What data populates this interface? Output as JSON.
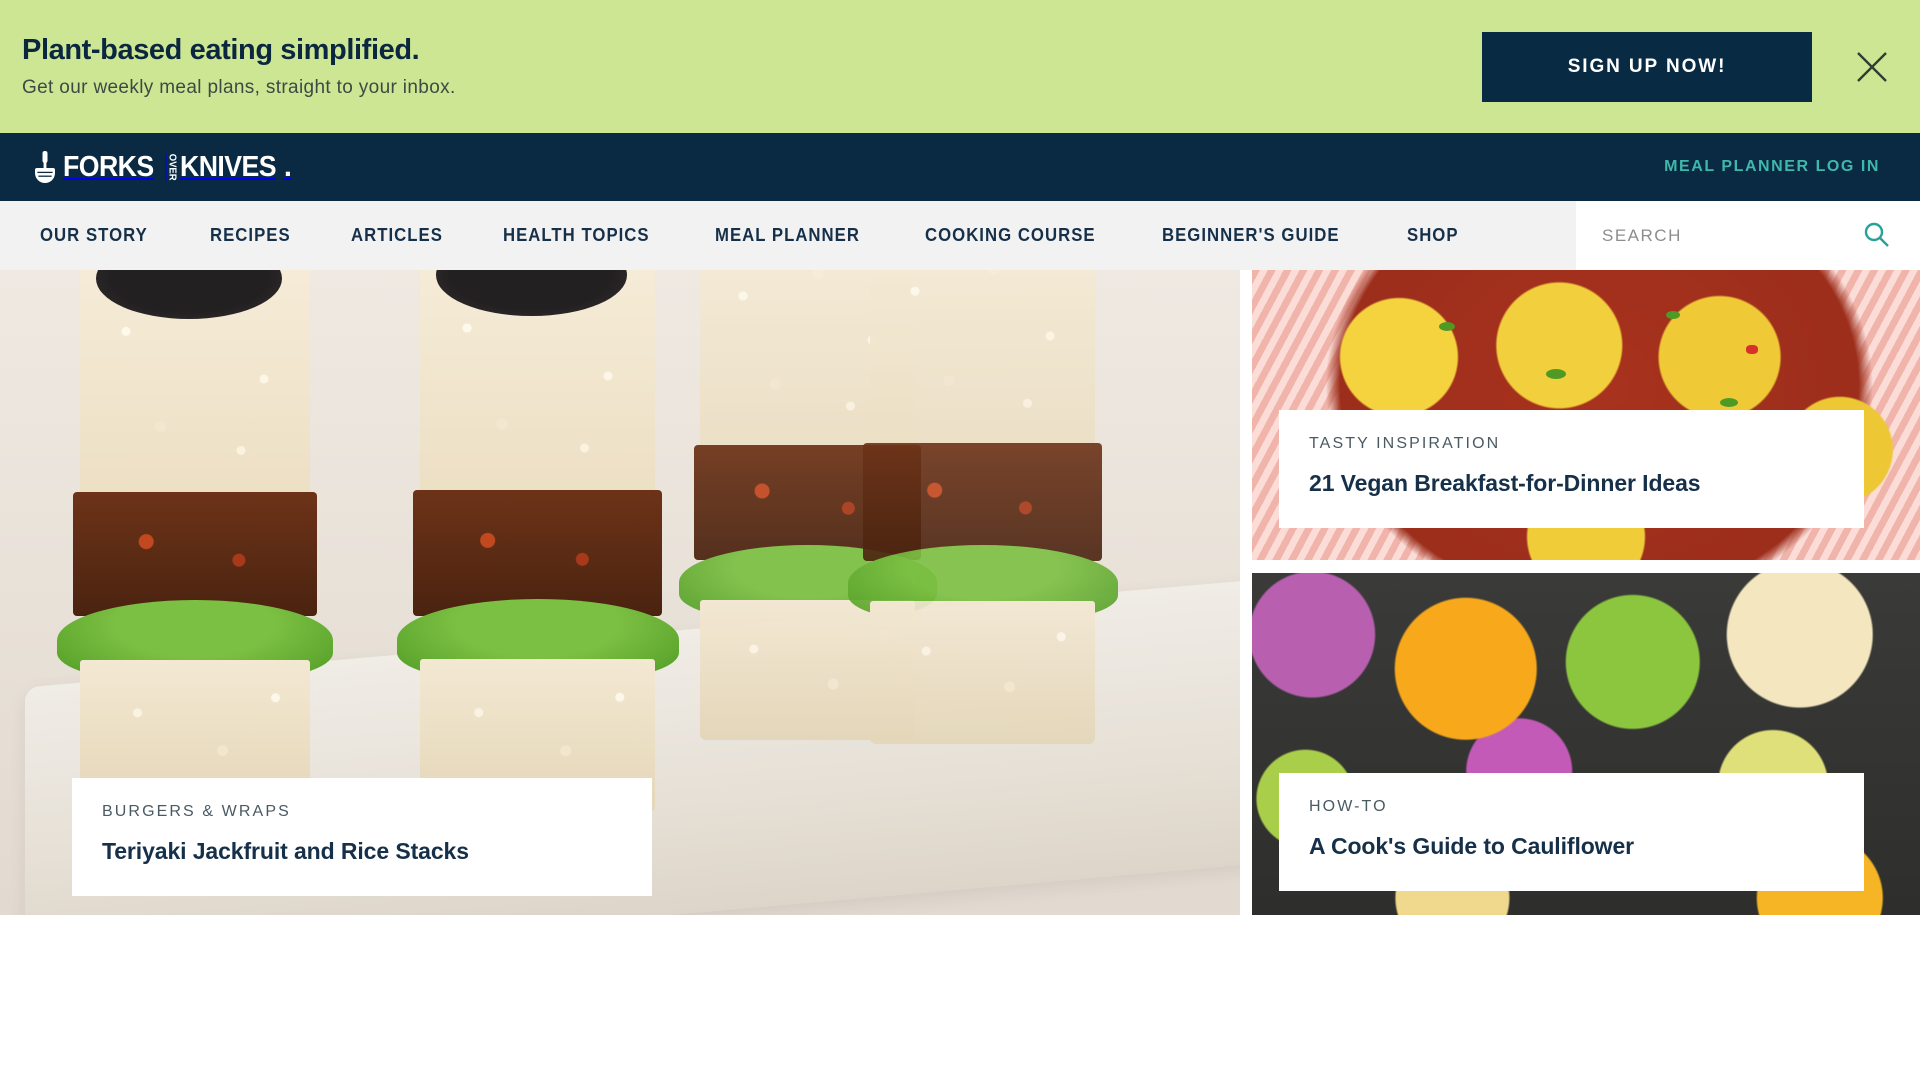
{
  "promo": {
    "title": "Plant-based eating simplified.",
    "subtitle": "Get our weekly meal plans, straight to your inbox.",
    "signup_label": "SIGN UP NOW!",
    "close_icon": "close-icon",
    "bg_color": "#cde694",
    "button_color": "#082b43"
  },
  "topbar": {
    "logo_forks": "FORKS",
    "logo_over": "OVER",
    "logo_knives": "KNIVES",
    "logo_dot": ".",
    "login_label": "MEAL PLANNER LOG IN",
    "login_color": "#3fb8ab",
    "bg_color": "#0a2a43"
  },
  "nav": {
    "items": [
      {
        "label": "OUR STORY"
      },
      {
        "label": "RECIPES"
      },
      {
        "label": "ARTICLES"
      },
      {
        "label": "HEALTH TOPICS"
      },
      {
        "label": "MEAL PLANNER"
      },
      {
        "label": "COOKING COURSE"
      },
      {
        "label": "BEGINNER'S GUIDE"
      },
      {
        "label": "SHOP"
      }
    ],
    "bg_color": "#f2f2f2"
  },
  "search": {
    "value": "",
    "placeholder": "SEARCH",
    "icon": "search-icon",
    "icon_color": "#2aa198"
  },
  "cards": [
    {
      "kicker": "BURGERS & WRAPS",
      "title": "Teriyaki Jackfruit and Rice Stacks",
      "image_alt": "teriyaki-jackfruit-rice-stacks-photo"
    },
    {
      "kicker": "TASTY INSPIRATION",
      "title": "21 Vegan Breakfast-for-Dinner Ideas",
      "image_alt": "vegan-breakfast-for-dinner-photo"
    },
    {
      "kicker": "HOW-TO",
      "title": "A Cook's Guide to Cauliflower",
      "image_alt": "colorful-cauliflower-photo"
    }
  ]
}
